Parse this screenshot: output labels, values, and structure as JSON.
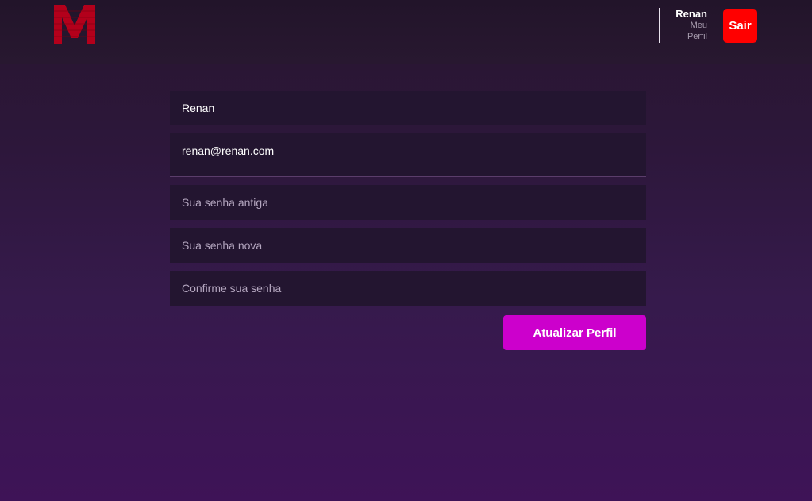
{
  "header": {
    "logo_letter": "M",
    "user_name": "Renan",
    "profile_link": "Meu Perfil",
    "logout_label": "Sair"
  },
  "form": {
    "name_value": "Renan",
    "email_value": "renan@renan.com",
    "old_password_placeholder": "Sua senha antiga",
    "new_password_placeholder": "Sua senha nova",
    "confirm_password_placeholder": "Confirme sua senha",
    "submit_label": "Atualizar Perfil"
  },
  "colors": {
    "logo": "#b3001b",
    "logout_button": "#ff0000",
    "submit_button": "#cc00cc"
  }
}
